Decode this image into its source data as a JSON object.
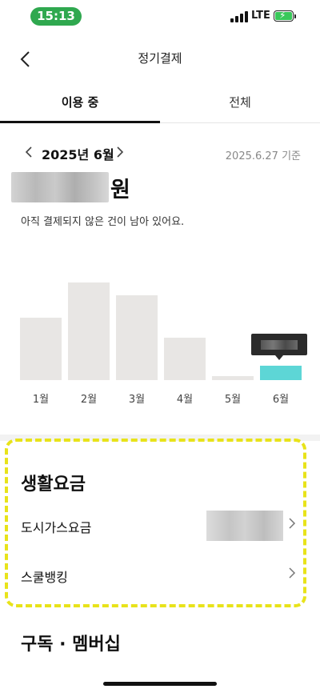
{
  "status_bar": {
    "time": "15:13",
    "network": "LTE",
    "battery_level": 1.0,
    "colors": {
      "time_pill": "#2fa84f",
      "battery": "#39c85a"
    }
  },
  "header": {
    "title": "정기결제",
    "back_icon": "chevron-left-icon"
  },
  "tabs": [
    {
      "label": "이용 중",
      "active": true
    },
    {
      "label": "전체",
      "active": false
    }
  ],
  "summary": {
    "month_label": "2025년 6월",
    "prev_icon": "chevron-left-icon",
    "next_icon": "chevron-right-icon",
    "as_of": "2025.6.27 기준",
    "amount_currency": "원",
    "notice": "아직 결제되지 않은 건이 남아 있어요."
  },
  "chart_data": {
    "type": "bar",
    "categories": [
      "1월",
      "2월",
      "3월",
      "4월",
      "5월",
      "6월"
    ],
    "values": [
      77,
      120,
      104,
      52,
      5,
      18
    ],
    "highlighted_category": "6월",
    "colors": {
      "bar": "#e8e6e4",
      "active_bar": "#5dd6d6",
      "tooltip": "#2b2b2b"
    }
  },
  "sections": [
    {
      "title": "생활요금",
      "items": [
        {
          "label": "도시가스요금",
          "has_blurred_value": true
        },
        {
          "label": "스쿨뱅킹",
          "has_blurred_value": false
        }
      ]
    },
    {
      "title": "구독 · 멤버십",
      "items": []
    }
  ],
  "annotation_color": "#e8e31a"
}
